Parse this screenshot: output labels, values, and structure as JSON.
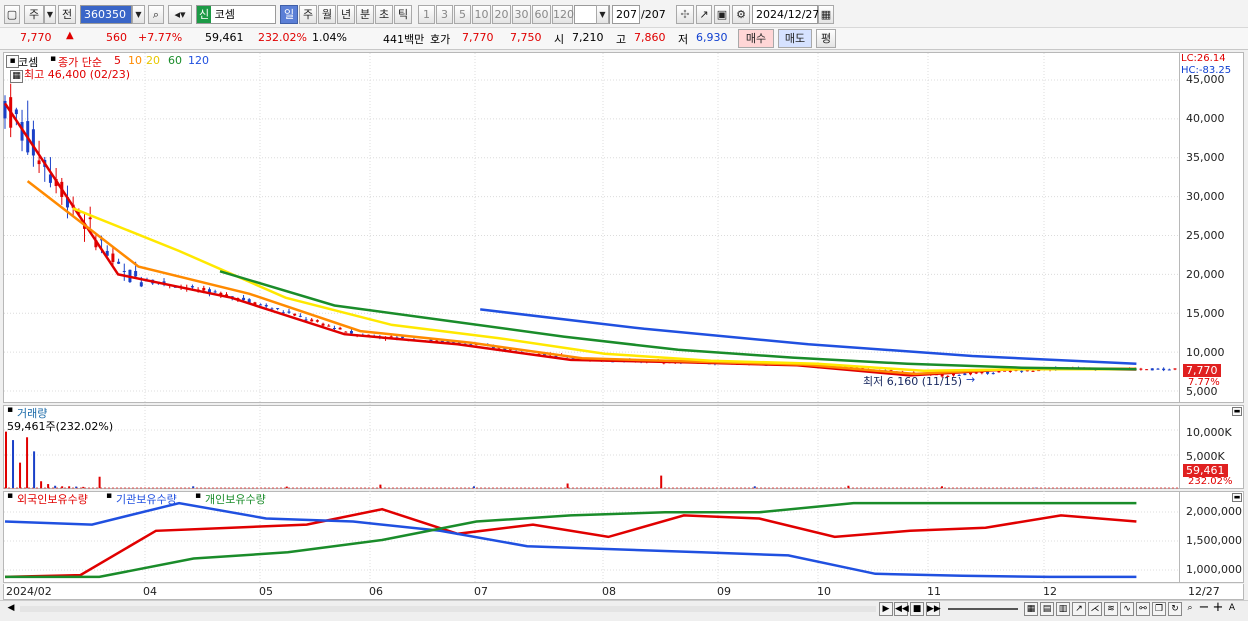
{
  "toolbar": {
    "period_options": [
      "주",
      "전"
    ],
    "stock_code": "360350",
    "market_badge": "신",
    "stock_name": "코셈",
    "periods": [
      "일",
      "주",
      "월",
      "년",
      "분",
      "초",
      "틱"
    ],
    "selected_period": "일",
    "minute_options": [
      "1",
      "3",
      "5",
      "10",
      "20",
      "30",
      "60",
      "120"
    ],
    "count_current": "207",
    "count_total": "/207",
    "date": "2024/12/27"
  },
  "quote": {
    "price": "7,770",
    "change": "560",
    "change_pct": "+7.77%",
    "volume": "59,461",
    "volume_pct": "232.02%",
    "turnover": "1.04%",
    "amount": "441백만",
    "bid_ask_label": "호가",
    "ask": "7,770",
    "bid": "7,750",
    "open_label": "시",
    "open": "7,210",
    "high_label": "고",
    "high": "7,860",
    "low_label": "저",
    "low": "6,930",
    "buy_button": "매수",
    "sell_button": "매도",
    "eval_button": "평"
  },
  "price_pane": {
    "name": "코셈",
    "indicator_label": "종가 단순",
    "ma_periods": [
      "5",
      "10",
      "20",
      "60",
      "120"
    ],
    "high_note": "최고 46,400 (02/23)",
    "low_note": "최저 6,160 (11/15)",
    "lc": "LC:26.14",
    "hc": "HC:-83.25",
    "current_badge": "7,770",
    "pct_badge": "7.77%",
    "y_ticks": [
      "45,000",
      "40,000",
      "35,000",
      "30,000",
      "25,000",
      "20,000",
      "15,000",
      "10,000",
      "5,000"
    ]
  },
  "volume_pane": {
    "title": "거래량",
    "value": "59,461주(232.02%)",
    "y_ticks": [
      "10,000K",
      "5,000K"
    ],
    "badge": "59,461",
    "badge_pct": "232.02%"
  },
  "holding_pane": {
    "titles": [
      "외국인보유수량",
      "기관보유수량",
      "개인보유수량"
    ],
    "y_ticks": [
      "2,000,000",
      "1,500,000",
      "1,000,000"
    ]
  },
  "x_axis": {
    "labels": [
      "2024/02",
      "04",
      "05",
      "06",
      "07",
      "08",
      "09",
      "10",
      "11",
      "12"
    ],
    "end_label": "12/27"
  },
  "colors": {
    "ma5": "#e00000",
    "ma10": "#ff8a00",
    "ma20": "#ffe800",
    "ma60": "#1a8c2a",
    "ma120": "#2050e0",
    "up": "#e00000",
    "down": "#1a40c8"
  },
  "chart_data": [
    {
      "type": "line",
      "title": "코셈",
      "ylim": [
        5000,
        46000
      ],
      "x": [
        "2024/02",
        "04",
        "05",
        "06",
        "07",
        "08",
        "09",
        "10",
        "11",
        "12",
        "12/27"
      ],
      "series": [
        {
          "name": "5",
          "values": [
            42000,
            20000,
            17000,
            12300,
            11000,
            9000,
            8700,
            8300,
            7000,
            7900,
            7770
          ]
        },
        {
          "name": "10",
          "values": [
            32000,
            21000,
            17500,
            12700,
            11200,
            9200,
            8800,
            8400,
            7200,
            7900,
            7850
          ]
        },
        {
          "name": "20",
          "values": [
            28500,
            23000,
            17000,
            13500,
            11800,
            9800,
            8900,
            8500,
            7600,
            7800,
            7800
          ]
        },
        {
          "name": "60",
          "values": [
            20400,
            16000,
            14000,
            12000,
            10300,
            9300,
            8500,
            8000,
            7800
          ]
        },
        {
          "name": "120",
          "values": [
            15500,
            13000,
            11000,
            9500,
            8500
          ]
        }
      ],
      "annotations": [
        "최고 46,400 (02/23)",
        "최저 6,160 (11/15)"
      ],
      "legend": "top-left"
    },
    {
      "type": "bar",
      "title": "거래량",
      "ylim": [
        0,
        11000
      ],
      "unit": "K",
      "values": [
        10000,
        8500,
        4500,
        9000,
        6500,
        1200,
        700,
        400,
        300,
        300,
        250,
        200,
        2000,
        300,
        250,
        600,
        300,
        800,
        2200,
        300,
        400,
        300,
        59
      ]
    },
    {
      "type": "line",
      "title": "외국인보유수량 · 기관보유수량 · 개인보유수량",
      "ylim": [
        850000,
        2150000
      ],
      "series": [
        {
          "name": "외국인보유수량",
          "values": [
            900000,
            930000,
            1650000,
            1700000,
            1750000,
            2000000,
            1600000,
            1750000,
            1550000,
            1900000,
            1850000,
            1550000,
            1650000,
            1700000,
            1900000,
            1800000
          ]
        },
        {
          "name": "기관보유수량",
          "values": [
            1800000,
            1750000,
            2100000,
            1850000,
            1800000,
            1650000,
            1400000,
            1350000,
            1300000,
            1250000,
            950000,
            920000,
            900000,
            900000
          ]
        },
        {
          "name": "개인보유수량",
          "values": [
            900000,
            900000,
            1200000,
            1300000,
            1500000,
            1800000,
            1900000,
            1950000,
            1950000,
            2100000,
            2100000,
            2100000,
            2100000
          ]
        }
      ]
    }
  ]
}
